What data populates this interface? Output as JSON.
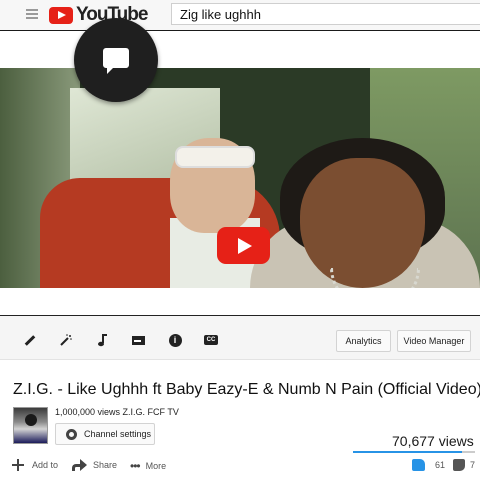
{
  "header": {
    "logo_text": "YouTube",
    "search_value": "Zig like ughhh"
  },
  "toolbar": {
    "icons": [
      "edit-icon",
      "magic-wand-icon",
      "music-note-icon",
      "card-icon",
      "info-icon",
      "cc-icon"
    ],
    "analytics_label": "Analytics",
    "video_manager_label": "Video Manager"
  },
  "video": {
    "title": "Z.I.G. - Like Ughhh ft Baby Eazy-E & Numb N Pain (Official Video)",
    "subscriber_line": "1,000,000 views Z.I.G. FCF TV",
    "channel_settings_label": "Channel settings",
    "view_count": "70,677 views",
    "likes": "61",
    "dislikes": "7",
    "like_ratio": 0.897
  },
  "actions": {
    "add_label": "Add to",
    "share_label": "Share",
    "more_label": "More"
  },
  "colors": {
    "brand_red": "#e62117",
    "like_blue": "#2793e6"
  }
}
